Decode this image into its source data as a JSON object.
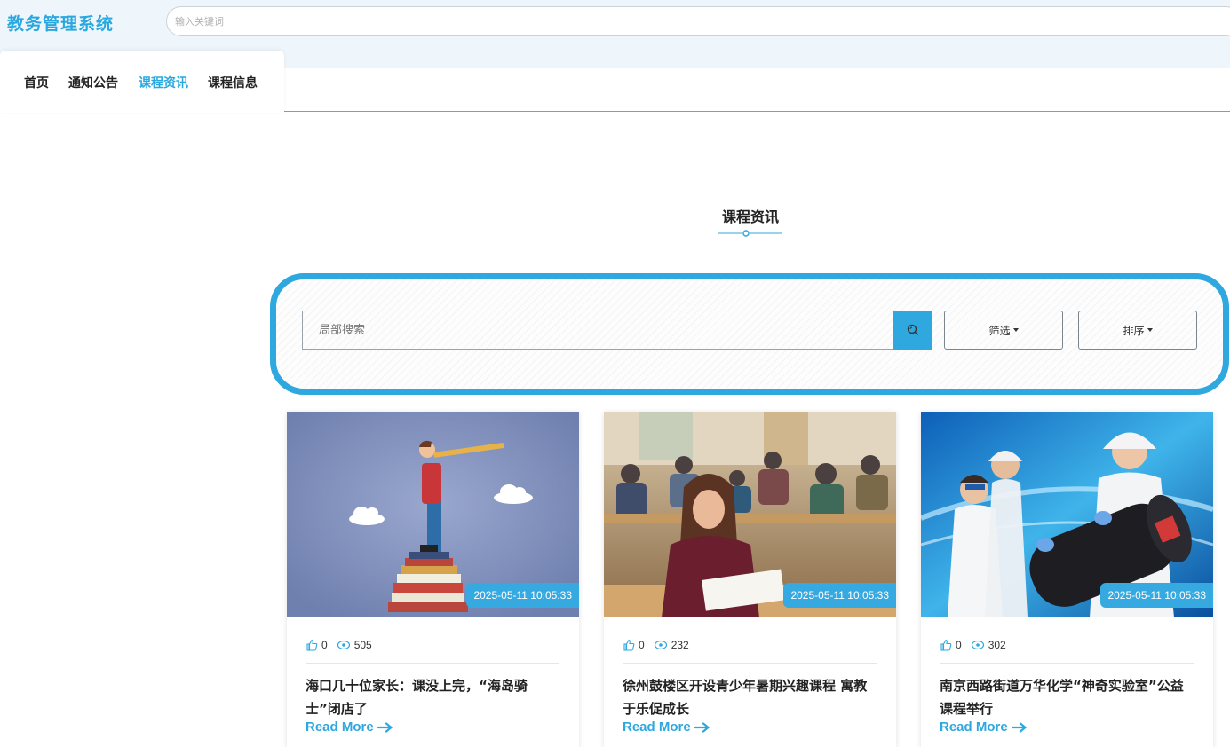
{
  "header": {
    "brand": "教务管理系统",
    "search_placeholder": "输入关键词"
  },
  "nav": {
    "items": [
      {
        "label": "首页",
        "active": false
      },
      {
        "label": "通知公告",
        "active": false
      },
      {
        "label": "课程资讯",
        "active": true
      },
      {
        "label": "课程信息",
        "active": false
      }
    ]
  },
  "section": {
    "title": "课程资讯"
  },
  "filters": {
    "search_placeholder": "局部搜索",
    "search_icon": "search-icon",
    "filter_label": "筛选",
    "sort_label": "排序"
  },
  "colors": {
    "accent": "#2fa7df",
    "brand": "#29a8e0"
  },
  "cards": [
    {
      "date": "2025-05-11 10:05:33",
      "likes": "0",
      "views": "505",
      "title": "海口几十位家长：课没上完，“海岛骑士”闭店了",
      "read_more": "Read More"
    },
    {
      "date": "2025-05-11 10:05:33",
      "likes": "0",
      "views": "232",
      "title": "徐州鼓楼区开设青少年暑期兴趣课程 寓教于乐促成长",
      "read_more": "Read More"
    },
    {
      "date": "2025-05-11 10:05:33",
      "likes": "0",
      "views": "302",
      "title": "南京西路街道万华化学“神奇实验室”公益课程举行",
      "read_more": "Read More"
    }
  ]
}
